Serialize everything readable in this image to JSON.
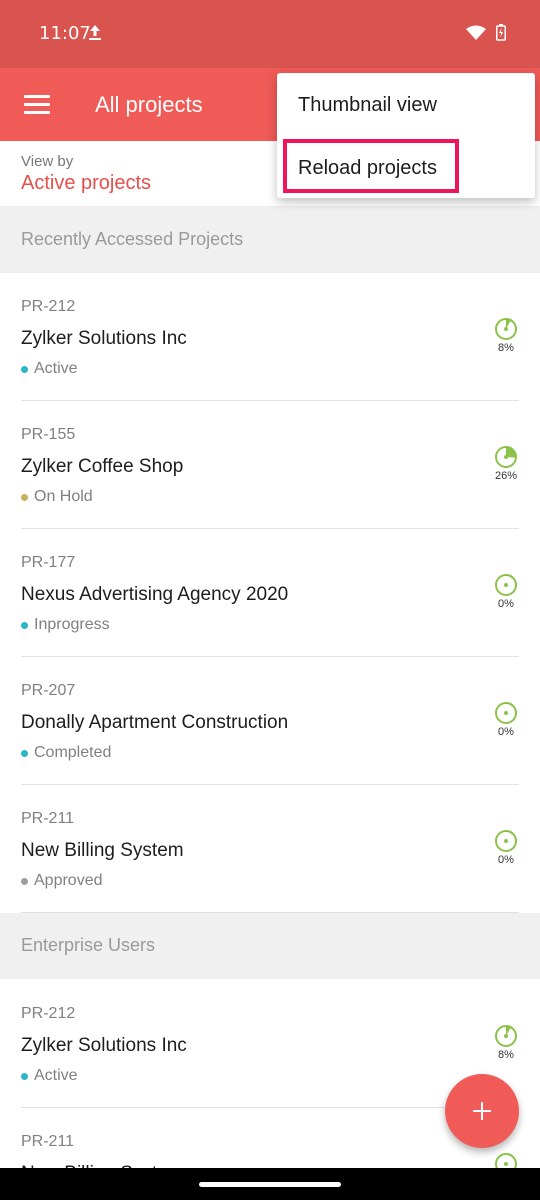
{
  "status_bar": {
    "time": "11:07"
  },
  "app_bar": {
    "title": "All projects"
  },
  "view_by": {
    "label": "View by",
    "value": "Active projects"
  },
  "sections": [
    {
      "title": "Recently Accessed Projects"
    },
    {
      "title": "Enterprise Users"
    }
  ],
  "recent_projects": [
    {
      "id": "PR-212",
      "name": "Zylker Solutions Inc",
      "status": "Active",
      "status_color": "#29b6c8",
      "progress": "8%",
      "progress_value": 0.08
    },
    {
      "id": "PR-155",
      "name": "Zylker Coffee Shop",
      "status": "On Hold",
      "status_color": "#c4b35a",
      "progress": "26%",
      "progress_value": 0.26
    },
    {
      "id": "PR-177",
      "name": "Nexus Advertising Agency 2020",
      "status": "Inprogress",
      "status_color": "#29b6c8",
      "progress": "0%",
      "progress_value": 0
    },
    {
      "id": "PR-207",
      "name": "Donally Apartment Construction",
      "status": "Completed",
      "status_color": "#29b6c8",
      "progress": "0%",
      "progress_value": 0
    },
    {
      "id": "PR-211",
      "name": "New Billing System",
      "status": "Approved",
      "status_color": "#9e9e9e",
      "progress": "0%",
      "progress_value": 0
    }
  ],
  "enterprise_projects": [
    {
      "id": "PR-212",
      "name": "Zylker Solutions Inc",
      "status": "Active",
      "status_color": "#29b6c8",
      "progress": "8%",
      "progress_value": 0.08
    },
    {
      "id": "PR-211",
      "name": "New Billing System",
      "status": "",
      "status_color": "#9e9e9e",
      "progress": "",
      "progress_value": 0
    }
  ],
  "popup_menu": {
    "items": [
      "Thumbnail view",
      "Reload projects"
    ]
  },
  "colors": {
    "accent": "#f05a57",
    "progress": "#8bc34a",
    "highlight": "#f0145a"
  }
}
